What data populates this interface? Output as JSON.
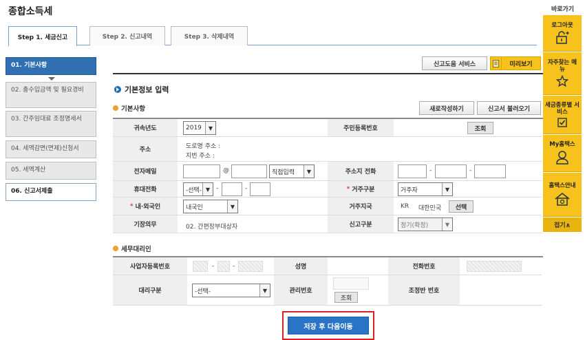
{
  "page_title": "종합소득세",
  "tabs": [
    {
      "label": "Step 1. 세금신고",
      "active": true
    },
    {
      "label": "Step 2. 신고내역",
      "active": false
    },
    {
      "label": "Step 3. 삭제내역",
      "active": false
    }
  ],
  "steps": [
    {
      "label": "01. 기본사항"
    },
    {
      "label": "02. 총수입금액 및 필요경비"
    },
    {
      "label": "03. 간주임대료 조정명세서"
    },
    {
      "label": "04. 세액감면(면제)신청서"
    },
    {
      "label": "05. 세액계산"
    },
    {
      "label": "06. 신고서제출"
    }
  ],
  "top_buttons": {
    "help_service": "신고도움 서비스",
    "preview": "미리보기"
  },
  "basic_info": {
    "section_title": "기본정보 입력",
    "sub_title": "기본사항",
    "new_button": "새로작성하기",
    "load_button": "신고서 불러오기",
    "fields": {
      "year_label": "귀속년도",
      "year_value": "2019",
      "ssn_label": "주민등록번호",
      "ssn_lookup": "조회",
      "address_label": "주소",
      "road_address": "도로명 주소 :",
      "lot_address": "지번 주소 :",
      "email_label": "전자메일",
      "email_at": "@",
      "email_domain": "직접입력",
      "phone_label": "주소지 전화",
      "dash": "-",
      "mobile_label": "휴대전화",
      "mobile_select": "-선택-",
      "residence_label": "거주구분",
      "residence_value": "거주자",
      "nationality_label": "내·외국인",
      "nationality_value": "내국인",
      "residence_country_label": "거주지국",
      "country_code": "KR",
      "country_name": "대한민국",
      "country_select": "선택",
      "bookkeeping_label": "기장의무",
      "bookkeeping_value": "02. 간편장부대상자",
      "report_type_label": "신고구분",
      "report_type_value": "정기(확정)"
    }
  },
  "tax_agent": {
    "sub_title": "세무대리인",
    "biz_no_label": "사업자등록번호",
    "name_label": "성명",
    "phone_label": "전화번호",
    "type_label": "대리구분",
    "type_select": "-선택-",
    "mgmt_no_label": "관리번호",
    "mgmt_lookup": "조회",
    "adjust_no_label": "조정반 번호"
  },
  "save_button": "저장 후 다음이동",
  "sidebar": {
    "header": "바로가기",
    "items": [
      {
        "label": "로그아웃",
        "icon": "logout-lock-icon"
      },
      {
        "label": "자주찾는 메뉴",
        "icon": "star-icon"
      },
      {
        "label": "세금종류별 서비스",
        "icon": "checkbox-icon"
      },
      {
        "label": "My홈택스",
        "icon": "user-icon"
      },
      {
        "label": "홈택스안내",
        "icon": "home-info-icon"
      }
    ],
    "close": "접기∧"
  },
  "colors": {
    "accent": "#2f6fb2",
    "sidebar": "#f7c21b",
    "highlight": "#e02020"
  }
}
